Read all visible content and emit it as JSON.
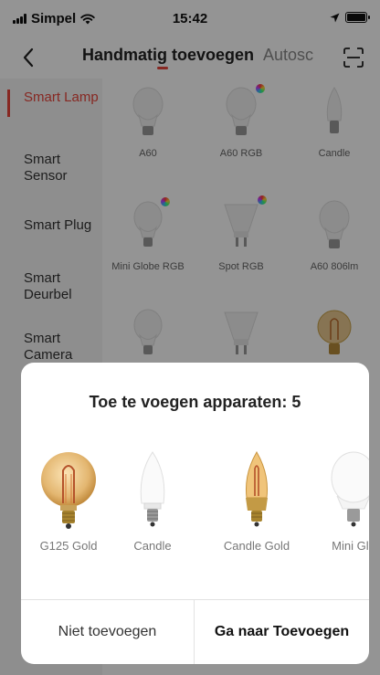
{
  "status_bar": {
    "carrier": "Simpel",
    "time": "15:42"
  },
  "nav": {
    "tab_manual": "Handmatig toevoegen",
    "tab_auto": "Autosc"
  },
  "sidebar": {
    "items": [
      {
        "label": "Smart Lamp"
      },
      {
        "label": "Smart Sensor"
      },
      {
        "label": "Smart Plug"
      },
      {
        "label": "Smart Deurbel"
      },
      {
        "label": "Smart Camera"
      }
    ]
  },
  "grid": {
    "products": [
      {
        "label": "A60",
        "icon": "bulb-icon"
      },
      {
        "label": "A60 RGB",
        "icon": "bulb-rgb-icon"
      },
      {
        "label": "Candle",
        "icon": "candle-bulb-icon"
      },
      {
        "label": "Mini Globe RGB",
        "icon": "bulb-rgb-icon"
      },
      {
        "label": "Spot RGB",
        "icon": "spot-rgb-icon"
      },
      {
        "label": "A60 806lm",
        "icon": "bulb-icon"
      },
      {
        "label": "",
        "icon": "bulb-icon"
      },
      {
        "label": "",
        "icon": "spot-icon"
      },
      {
        "label": "",
        "icon": "filament-globe-icon"
      }
    ]
  },
  "modal": {
    "title": "Toe te voegen apparaten: 5",
    "devices": [
      {
        "label": "G125 Gold",
        "icon": "filament-globe-icon"
      },
      {
        "label": "Candle",
        "icon": "candle-bulb-icon"
      },
      {
        "label": "Candle Gold",
        "icon": "candle-gold-icon"
      },
      {
        "label": "Mini Glo",
        "icon": "bulb-icon"
      }
    ],
    "skip_label": "Niet toevoegen",
    "go_label": "Ga naar Toevoegen"
  },
  "colors": {
    "accent": "#e8453c",
    "gold": "#c9a24a"
  }
}
